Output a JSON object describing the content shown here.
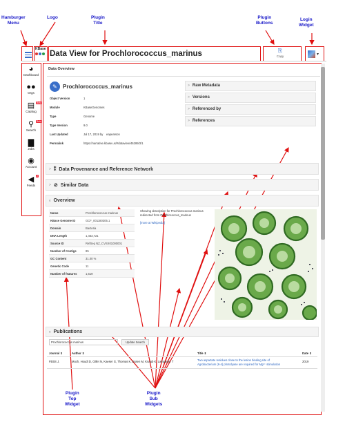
{
  "annotations": {
    "hamburger": "Hamburger\nMenu",
    "logo": "Logo",
    "plugin_title": "Plugin\nTitle",
    "plugin_buttons": "Plugin\nButtons",
    "login_widget": "Login\nWidget",
    "plugin_top_widget": "Plugin\nTop\nWidget",
    "plugin_sub_widgets": "Plugin\nSub\nWidgets"
  },
  "header": {
    "logo_text": "KBase",
    "title": "Data View for Prochlorococcus_marinus",
    "copy_label": "Copy"
  },
  "sidebar": {
    "items": [
      {
        "label": "Dashboard",
        "icon": "dashboard-icon"
      },
      {
        "label": "Orgs",
        "icon": "orgs-icon"
      },
      {
        "label": "Catalog",
        "icon": "catalog-icon",
        "badge": "Beta"
      },
      {
        "label": "Search",
        "icon": "search-icon",
        "badge": "Beta"
      },
      {
        "label": "Jobs",
        "icon": "jobs-icon"
      },
      {
        "label": "Account",
        "icon": "account-icon"
      },
      {
        "label": "Feeds",
        "icon": "feeds-icon",
        "badge": "2"
      }
    ]
  },
  "data_overview": {
    "heading": "Data Overview",
    "object_name": "Prochlorococcus_marinus",
    "fields": [
      {
        "key": "Object Version",
        "value": "1"
      },
      {
        "key": "Module",
        "value": "KBaseGenomes"
      },
      {
        "key": "Type",
        "value": "Genome"
      },
      {
        "key": "Type Version",
        "value": "9.0"
      },
      {
        "key": "Last Updated",
        "value": "Jul 17, 2019 by",
        "extra": "eapearson"
      },
      {
        "key": "Permalink",
        "value": "https://narrative.kbase.us/#dataview/46289/3/1"
      }
    ],
    "side_panels": [
      "Raw Metadata",
      "Versions",
      "Referenced by",
      "References"
    ]
  },
  "sections": {
    "provenance": "Data Provenance and Reference Network",
    "similar": "Similar Data",
    "overview": "Overview",
    "publications": "Publications"
  },
  "overview": {
    "fields": [
      {
        "key": "Name",
        "value": "Prochlorococcus marinus"
      },
      {
        "key": "KBase Genome ID",
        "value": "GCF_001180305.1"
      },
      {
        "key": "Domain",
        "value": "Bacteria"
      },
      {
        "key": "DNA Length",
        "value": "1,463,721"
      },
      {
        "key": "Source ID",
        "value": "RefSeq NZ_CVSX01000001"
      },
      {
        "key": "Number of Contigs",
        "value": "85"
      },
      {
        "key": "GC Content",
        "value": "31.00 %"
      },
      {
        "key": "Genetic Code",
        "value": "11"
      },
      {
        "key": "Number of features",
        "value": "1,619"
      }
    ],
    "description_line1": "Showing description for Prochlorococcus marinus",
    "description_line2": "redirected from Prochlococcus_marinus",
    "wiki_link": "[more at Wikipedia]"
  },
  "publications": {
    "search_value": "Prochlorococcus marinus",
    "update_button": "Update Search",
    "columns": [
      "Journal ⇕",
      "Author ⇕",
      "Title ⇕",
      "Date ⇕"
    ],
    "rows": [
      {
        "journal": "FEBS J.",
        "author": "Much, Houdt D, Gillet N, Kaeser G, Thomas K, Essen M, Knaub K, Lamparter T",
        "title_line1": "Two aspartate residues close to the lesion binding site of",
        "title_line2": "Agrobacterium (6-4) photolyase are required for Mg²⁺ stimulation",
        "date": "2019"
      }
    ]
  }
}
